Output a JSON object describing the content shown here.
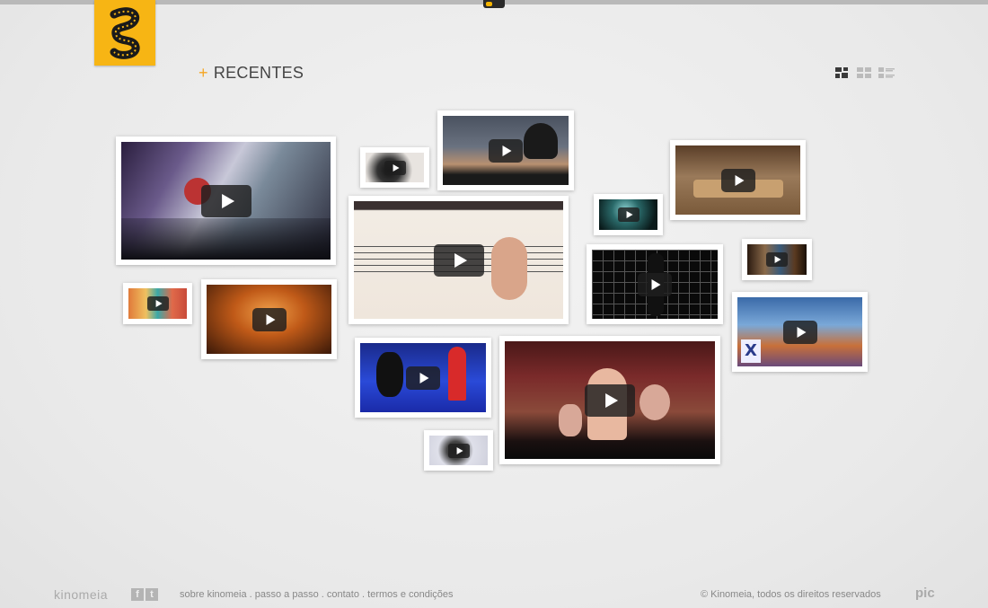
{
  "header": {
    "section_title": "RECENTES",
    "section_prefix": "+",
    "view_modes": [
      "mosaic-view-icon",
      "grid-view-icon",
      "list-view-icon"
    ]
  },
  "thumbnails": [
    {
      "id": "t1",
      "scene": "concert stage projection",
      "icon": "play-icon"
    },
    {
      "id": "t2",
      "scene": "dark splash",
      "icon": "play-icon"
    },
    {
      "id": "t3",
      "scene": "tree at dusk",
      "icon": "play-icon"
    },
    {
      "id": "t4",
      "scene": "birds on music staff",
      "icon": "play-icon"
    },
    {
      "id": "t5",
      "scene": "teal figure",
      "icon": "play-icon"
    },
    {
      "id": "t6",
      "scene": "dinner table",
      "icon": "play-icon"
    },
    {
      "id": "t7",
      "scene": "forest",
      "icon": "play-icon"
    },
    {
      "id": "t8",
      "scene": "grid dancer",
      "icon": "play-icon"
    },
    {
      "id": "t9",
      "scene": "upside-down canyon",
      "icon": "play-icon"
    },
    {
      "id": "t10",
      "scene": "colorful shapes",
      "icon": "play-icon"
    },
    {
      "id": "t11",
      "scene": "orange interior",
      "icon": "play-icon"
    },
    {
      "id": "t12",
      "scene": "red hood character",
      "icon": "play-icon"
    },
    {
      "id": "t13",
      "scene": "clay creatures",
      "icon": "play-icon"
    },
    {
      "id": "t14",
      "scene": "black rock",
      "icon": "play-icon"
    }
  ],
  "footer": {
    "brand": "kinomeia",
    "social": [
      "f",
      "t"
    ],
    "links": [
      "sobre kinomeia",
      "passo a passo",
      "contato",
      "termos e condições"
    ],
    "separator": " . ",
    "copyright": "© Kinomeia, todos os direitos reservados",
    "partner": "pic"
  },
  "colors": {
    "accent": "#f7b514",
    "plus": "#f5a623",
    "background": "#ececec"
  }
}
